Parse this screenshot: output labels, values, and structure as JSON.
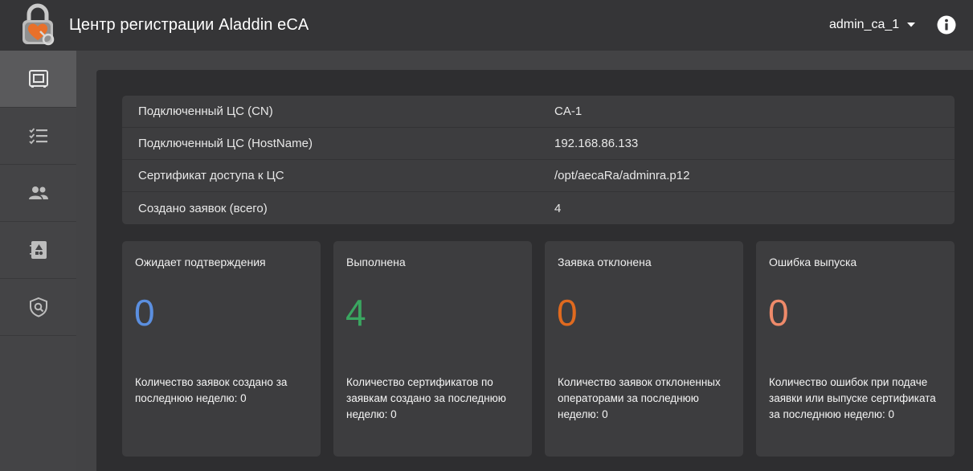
{
  "header": {
    "title": "Центр регистрации Aladdin eCA",
    "user": "admin_ca_1"
  },
  "sidebar": {
    "items": [
      {
        "icon": "dashboard-icon",
        "active": true
      },
      {
        "icon": "request-list-icon",
        "active": false
      },
      {
        "icon": "users-icon",
        "active": false
      },
      {
        "icon": "certificate-book-icon",
        "active": false
      },
      {
        "icon": "security-shield-icon",
        "active": false
      }
    ]
  },
  "info": {
    "rows": [
      {
        "label": "Подключенный ЦС (CN)",
        "value": "CA-1"
      },
      {
        "label": "Подключенный ЦС (HostName)",
        "value": "192.168.86.133"
      },
      {
        "label": "Сертификат доступа к ЦС",
        "value": "/opt/aecaRa/adminra.p12"
      },
      {
        "label": "Создано заявок (всего)",
        "value": "4"
      }
    ]
  },
  "cards": [
    {
      "title": "Ожидает подтверждения",
      "value": "0",
      "color": "#5b8fe0",
      "desc": "Количество заявок создано за последнюю неделю: 0"
    },
    {
      "title": "Выполнена",
      "value": "4",
      "color": "#3aa660",
      "desc": "Количество сертификатов по заявкам создано за последнюю неделю: 0"
    },
    {
      "title": "Заявка отклонена",
      "value": "0",
      "color": "#e06a1f",
      "desc": "Количество заявок отклоненных операторами за последнюю неделю: 0"
    },
    {
      "title": "Ошибка выпуска",
      "value": "0",
      "color": "#ee8a6a",
      "desc": "Количество ошибок при подаче заявки или выпуске сертификата за последнюю неделю: 0"
    }
  ]
}
